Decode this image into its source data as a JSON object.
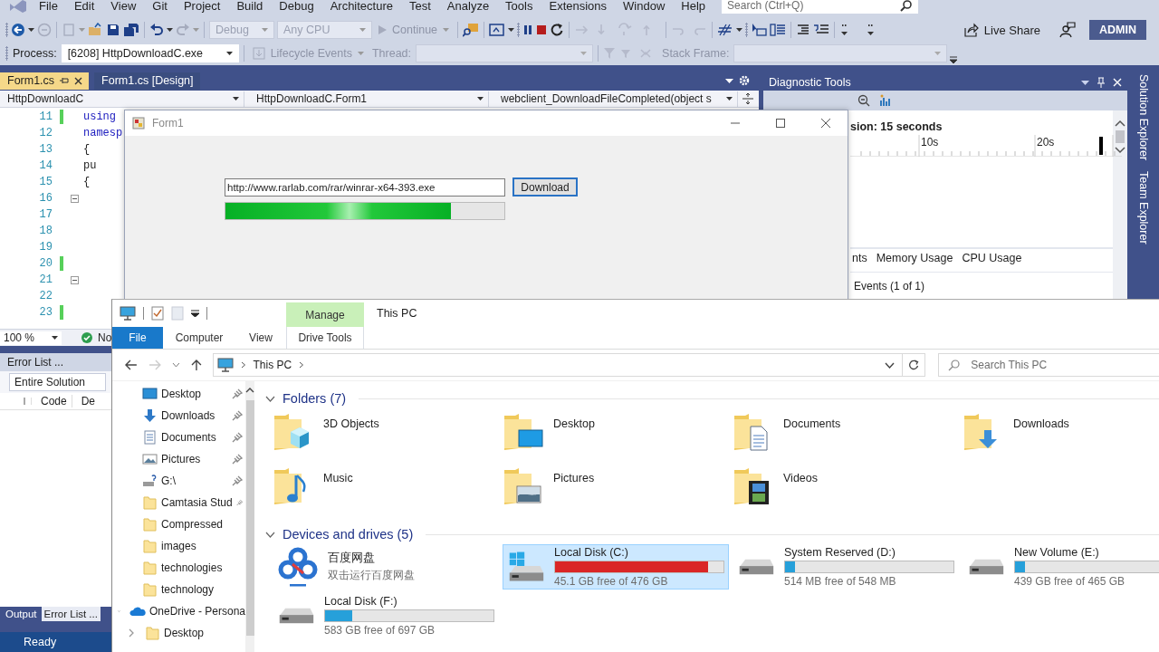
{
  "menu": [
    "File",
    "Edit",
    "View",
    "Git",
    "Project",
    "Build",
    "Debug",
    "Architecture",
    "Test",
    "Analyze",
    "Tools",
    "Extensions",
    "Window",
    "Help"
  ],
  "search": {
    "placeholder": "Search (Ctrl+Q)"
  },
  "toolbar": {
    "configuration": {
      "value": "Debug",
      "disabled": true
    },
    "platform": {
      "value": "Any CPU",
      "disabled": true
    },
    "continue": {
      "label": "Continue",
      "disabled": true
    },
    "live_share": "Live Share",
    "account": "ADMIN"
  },
  "debug_location": {
    "process_label": "Process:",
    "process": "[6208] HttpDownloadC.exe",
    "lifecycle": {
      "label": "Lifecycle Events",
      "disabled": true
    },
    "thread_label": "Thread:",
    "stack_frame_label": "Stack Frame:"
  },
  "editor_tabs": [
    {
      "label": "Form1.cs",
      "selected": true
    },
    {
      "label": "Form1.cs [Design]",
      "selected": false
    }
  ],
  "nav_bar": [
    "HttpDownloadC",
    "HttpDownloadC.Form1",
    "webclient_DownloadFileCompleted(object s"
  ],
  "code_lines": [
    {
      "number": "11",
      "code": "using",
      "changed": true,
      "fold": false
    },
    {
      "number": "12",
      "code": "namesp",
      "changed": false,
      "fold": false
    },
    {
      "number": "13",
      "code": "{",
      "changed": false,
      "fold": false
    },
    {
      "number": "14",
      "code": "pu",
      "changed": false,
      "fold": false
    },
    {
      "number": "15",
      "code": "{",
      "changed": false,
      "fold": false
    },
    {
      "number": "16",
      "changed": false,
      "fold": true
    },
    {
      "number": "17",
      "changed": false,
      "fold": false
    },
    {
      "number": "18",
      "changed": false,
      "fold": false
    },
    {
      "number": "19",
      "changed": false,
      "fold": false
    },
    {
      "number": "20",
      "changed": true,
      "fold": false
    },
    {
      "number": "21",
      "changed": false,
      "fold": true
    },
    {
      "number": "22",
      "changed": false,
      "fold": false
    },
    {
      "number": "23",
      "changed": true,
      "fold": false
    }
  ],
  "editor_footer": {
    "zoom": "100 %",
    "issues": "No"
  },
  "error_list": {
    "title": "Error List ...",
    "scope": "Entire Solution",
    "columns": [
      "Code",
      "De"
    ]
  },
  "bottom_tabs": [
    {
      "label": "Output",
      "selected": false
    },
    {
      "label": "Error List ...",
      "selected": true
    }
  ],
  "status_bar": "Ready",
  "diagnostic_tools": {
    "title": "Diagnostic Tools",
    "session": "sion: 15 seconds",
    "ruler": [
      "10s",
      "20s"
    ],
    "tabs": [
      "nts",
      "Memory Usage",
      "CPU Usage"
    ],
    "events": "Events (1 of 1)"
  },
  "side_tabs": [
    "Solution Explorer",
    "Team Explorer"
  ],
  "form": {
    "title": "Form1",
    "url": "http://www.rarlab.com/rar/winrar-x64-393.exe",
    "button": "Download",
    "progress": {
      "level": 0.81
    }
  },
  "explorer": {
    "ribbon": {
      "context_group": "Manage",
      "title": "This PC",
      "tabs": [
        {
          "label": "File",
          "kind": "file"
        },
        {
          "label": "Computer",
          "kind": "tab"
        },
        {
          "label": "View",
          "kind": "tab"
        },
        {
          "label": "Drive Tools",
          "kind": "contextual"
        }
      ]
    },
    "address": "This PC",
    "search": {
      "placeholder": "Search This PC"
    },
    "quick_access": [
      {
        "label": "Desktop",
        "kind": "desktop",
        "pinned": true
      },
      {
        "label": "Downloads",
        "kind": "downloads",
        "pinned": true
      },
      {
        "label": "Documents",
        "kind": "documents",
        "pinned": true
      },
      {
        "label": "Pictures",
        "kind": "pictures",
        "pinned": true
      },
      {
        "label": "G:\\",
        "kind": "drive",
        "pinned": true
      },
      {
        "label": "Camtasia Stud",
        "kind": "folder",
        "pinned": true
      },
      {
        "label": "Compressed",
        "kind": "folder",
        "pinned": false
      },
      {
        "label": "images",
        "kind": "folder",
        "pinned": false
      },
      {
        "label": "technologies",
        "kind": "folder",
        "pinned": false
      },
      {
        "label": "technology",
        "kind": "folder",
        "pinned": false
      }
    ],
    "tree": [
      {
        "label": "OneDrive - Persona",
        "kind": "cloud",
        "expanded": true,
        "children": [
          {
            "label": "Desktop",
            "kind": "folder",
            "expanded": false
          }
        ]
      }
    ],
    "folders": {
      "title": "Folders (7)",
      "items": [
        {
          "name": "3D Objects",
          "kind": "objects"
        },
        {
          "name": "Desktop",
          "kind": "desktop"
        },
        {
          "name": "Documents",
          "kind": "documents"
        },
        {
          "name": "Downloads",
          "kind": "downloads"
        },
        {
          "name": "Music",
          "kind": "music"
        },
        {
          "name": "Pictures",
          "kind": "pictures"
        },
        {
          "name": "Videos",
          "kind": "videos"
        }
      ]
    },
    "drives": {
      "title": "Devices and drives (5)",
      "items": [
        {
          "kind": "app",
          "name": "百度网盘",
          "detail": "双击运行百度网盘",
          "selected": false
        },
        {
          "kind": "drive",
          "name": "Local Disk (C:)",
          "level": 0.91,
          "free": "45.1 GB free of 476 GB",
          "system": true,
          "selected": true
        },
        {
          "kind": "drive",
          "name": "System Reserved (D:)",
          "level": 0.06,
          "free": "514 MB free of 548 MB",
          "system": false,
          "selected": false
        },
        {
          "kind": "drive",
          "name": "New Volume (E:)",
          "level": 0.06,
          "free": "439 GB free of 465 GB",
          "system": false,
          "selected": false
        },
        {
          "kind": "drive",
          "name": "Local Disk (F:)",
          "level": 0.16,
          "free": "583 GB free of 697 GB",
          "system": false,
          "selected": false
        }
      ]
    }
  }
}
